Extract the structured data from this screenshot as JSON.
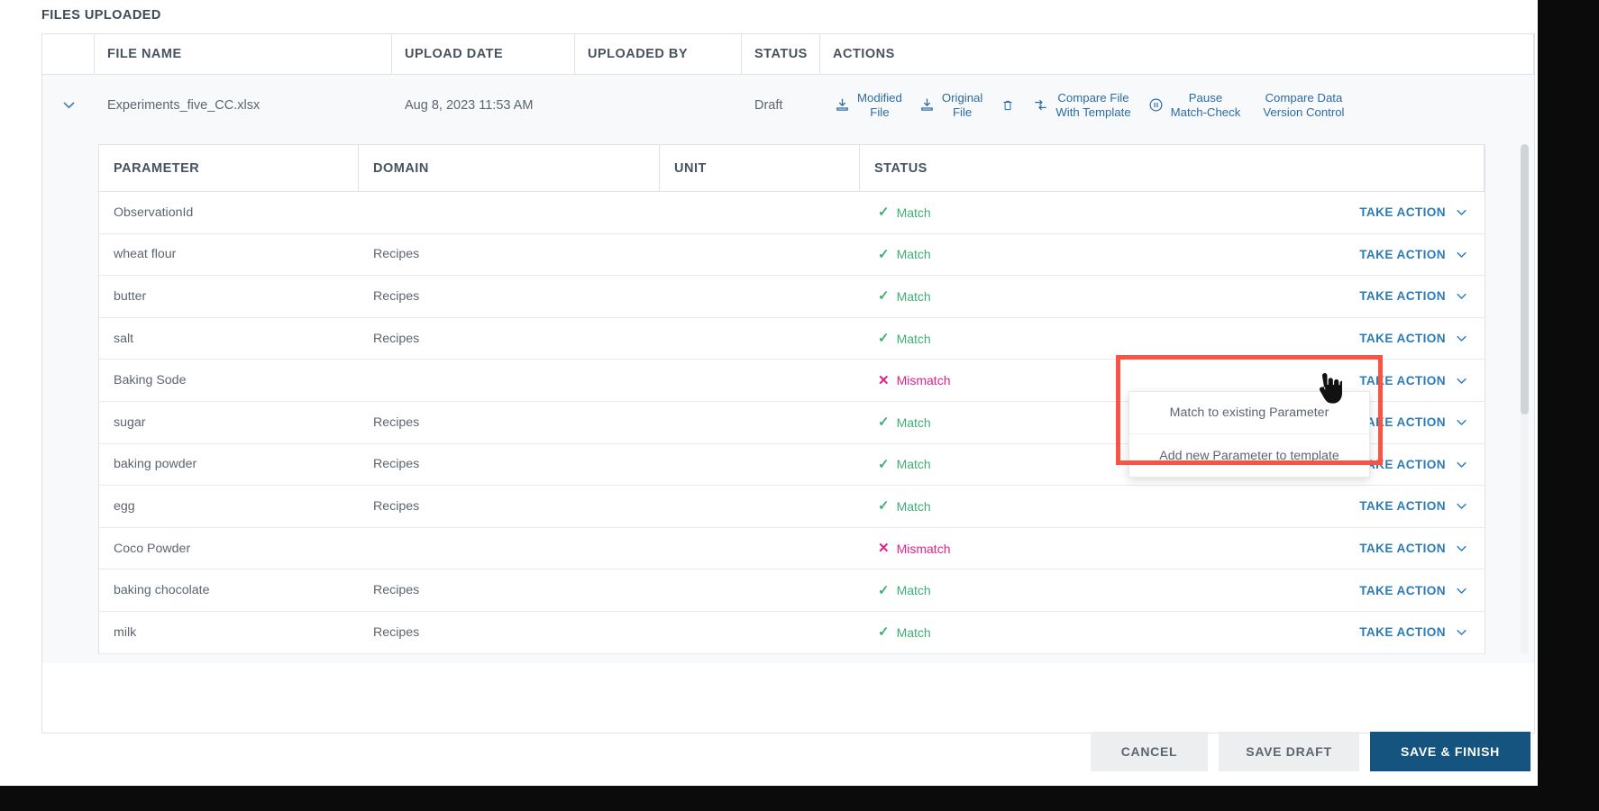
{
  "section": {
    "title": "FILES UPLOADED"
  },
  "outer_table": {
    "columns": [
      "",
      "FILE NAME",
      "UPLOAD DATE",
      "UPLOADED BY",
      "STATUS",
      "ACTIONS"
    ],
    "row": {
      "expand_icon": "chevron-down-icon",
      "file_name": "Experiments_five_CC.xlsx",
      "upload_date": "Aug 8, 2023 11:53 AM",
      "uploaded_by": "",
      "status": "Draft"
    },
    "actions": [
      {
        "icon": "download-icon",
        "line1": "Modified",
        "line2": "File"
      },
      {
        "icon": "download-icon",
        "line1": "Original",
        "line2": "File"
      },
      {
        "icon": "trash-icon",
        "line1": "",
        "line2": ""
      },
      {
        "icon": "compare-icon",
        "line1": "Compare File",
        "line2": "With Template"
      },
      {
        "icon": "pause-icon",
        "line1": "Pause",
        "line2": "Match-Check"
      },
      {
        "icon": "",
        "line1": "Compare Data",
        "line2": "Version Control"
      }
    ]
  },
  "inner_table": {
    "columns": [
      "PARAMETER",
      "DOMAIN",
      "UNIT",
      "STATUS"
    ],
    "action_label": "TAKE ACTION",
    "rows": [
      {
        "parameter": "ObservationId",
        "domain": "",
        "unit": "",
        "status": "Match",
        "status_type": "match"
      },
      {
        "parameter": "wheat flour",
        "domain": "Recipes",
        "unit": "",
        "status": "Match",
        "status_type": "match"
      },
      {
        "parameter": "butter",
        "domain": "Recipes",
        "unit": "",
        "status": "Match",
        "status_type": "match"
      },
      {
        "parameter": "salt",
        "domain": "Recipes",
        "unit": "",
        "status": "Match",
        "status_type": "match"
      },
      {
        "parameter": "Baking Sode",
        "domain": "",
        "unit": "",
        "status": "Mismatch",
        "status_type": "mismatch"
      },
      {
        "parameter": "sugar",
        "domain": "Recipes",
        "unit": "",
        "status": "Match",
        "status_type": "match"
      },
      {
        "parameter": "baking powder",
        "domain": "Recipes",
        "unit": "",
        "status": "Match",
        "status_type": "match"
      },
      {
        "parameter": "egg",
        "domain": "Recipes",
        "unit": "",
        "status": "Match",
        "status_type": "match"
      },
      {
        "parameter": "Coco Powder",
        "domain": "",
        "unit": "",
        "status": "Mismatch",
        "status_type": "mismatch"
      },
      {
        "parameter": "baking chocolate",
        "domain": "Recipes",
        "unit": "",
        "status": "Match",
        "status_type": "match"
      },
      {
        "parameter": "milk",
        "domain": "Recipes",
        "unit": "",
        "status": "Match",
        "status_type": "match"
      }
    ]
  },
  "dropdown": {
    "items": [
      "Match to existing Parameter",
      "Add new Parameter to template"
    ]
  },
  "footer": {
    "cancel": "CANCEL",
    "save_draft": "SAVE DRAFT",
    "save_finish": "SAVE & FINISH"
  },
  "colors": {
    "link": "#2b7bb9",
    "match": "#3fae77",
    "mismatch": "#e0218a",
    "primary_button": "#14547f",
    "highlight": "#fa5343"
  }
}
